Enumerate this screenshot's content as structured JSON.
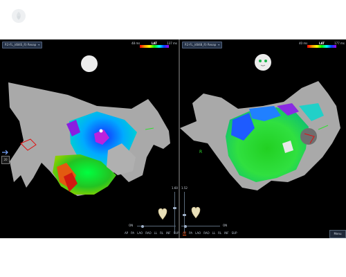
{
  "site": {
    "logo_icon": "leaf-dot-logo",
    "logo_color": "#e4e7ea"
  },
  "left_pane": {
    "map_dropdown": "P.2-FL_(484S_R) Rexap",
    "lat_legend": {
      "title": "LAT",
      "min": "48 ms",
      "max": "137 ms"
    },
    "orientation_icon": "blank-head-orientation-icon",
    "tool_value": "20",
    "slider_value": "1.60"
  },
  "right_pane": {
    "map_dropdown": "P.2-FL_(4848_R) Rexap",
    "lat_legend": {
      "title": "LAT",
      "min": "40 ms",
      "max": "177 ms"
    },
    "orientation_icon": "face-orientation-icon",
    "slider_value": "1.52"
  },
  "bottom_controls": {
    "opacity_left_label": "ON",
    "opacity_right_label": "ON",
    "view_buttons": [
      "AP",
      "PA",
      "LAO",
      "RAO",
      "LL",
      "RL",
      "INF",
      "SUP"
    ],
    "active_view": "AP",
    "menu_label": "Menu"
  },
  "colors": {
    "lat_gradient": [
      "#ff0000",
      "#ff9900",
      "#ffff00",
      "#00ff00",
      "#00ffff",
      "#0044ff",
      "#aa00ff"
    ],
    "anatomy_gray": "#a9a9a9",
    "active_view_color": "#ff5a1a"
  }
}
